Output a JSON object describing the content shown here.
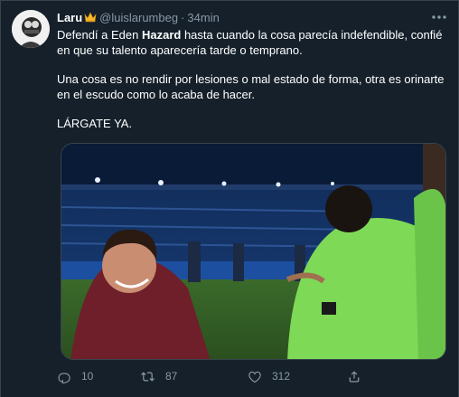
{
  "tweet": {
    "display_name": "Laru",
    "badge_icon": "crown-icon",
    "handle": "@luislarumbeg",
    "separator": "·",
    "time": "34min",
    "text": {
      "line1_before": "Defendí a Eden ",
      "line1_bold": "Hazard",
      "line1_after": " hasta cuando la cosa parecía indefendible, confié en que su talento aparecería tarde o temprano.",
      "paragraph2": "Una cosa es no rendir por lesiones o mal estado de forma, otra es orinarte en el escudo como lo acaba de hacer.",
      "paragraph3": "LÁRGATE YA."
    },
    "actions": {
      "reply_count": "10",
      "retweet_count": "87",
      "like_count": "312"
    }
  },
  "colors": {
    "background": "#15202b",
    "text": "#ffffff",
    "secondary": "#8899a6",
    "border": "#38444d",
    "crown": "#f7b928",
    "goalkeeper_kit": "#7ed957",
    "jacket": "#6e1f2a"
  }
}
